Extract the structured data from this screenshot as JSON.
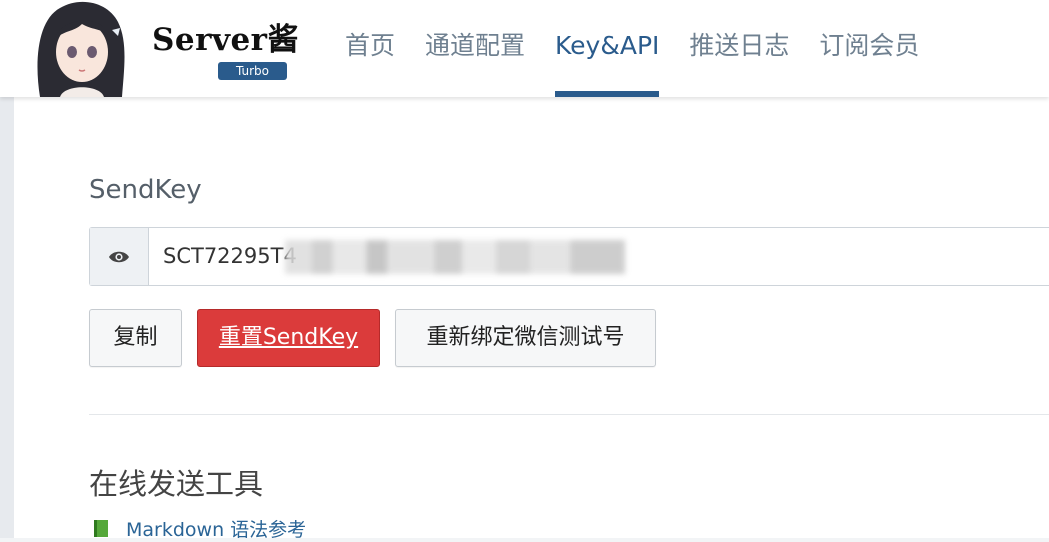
{
  "brand": {
    "title": "Server酱",
    "badge": "Turbo"
  },
  "nav": {
    "items": [
      {
        "label": "首页",
        "active": false
      },
      {
        "label": "通道配置",
        "active": false
      },
      {
        "label": "Key&API",
        "active": true
      },
      {
        "label": "推送日志",
        "active": false
      },
      {
        "label": "订阅会员",
        "active": false
      }
    ]
  },
  "sendkey": {
    "label": "SendKey",
    "value_visible": "SCT72295T4",
    "eye_icon": "eye-icon"
  },
  "actions": {
    "copy_label": "复制",
    "reset_label": "重置SendKey",
    "rebind_label": "重新绑定微信测试号"
  },
  "tools": {
    "title": "在线发送工具",
    "markdown_link": "Markdown 语法参考",
    "link_icon": "book-icon"
  },
  "colors": {
    "accent": "#2a5b8c",
    "danger": "#db3b3b",
    "nav_inactive": "#6f8090",
    "link": "#2a6496",
    "book": "#55a83a"
  }
}
